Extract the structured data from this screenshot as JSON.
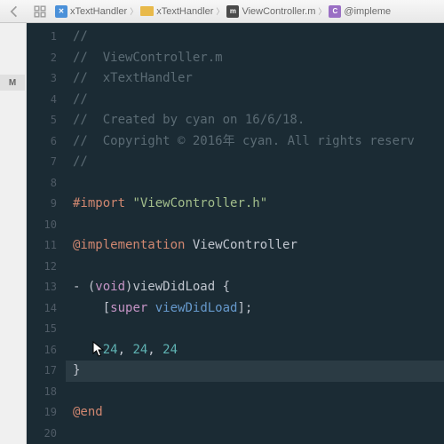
{
  "toolbar": {
    "back_icon": "chevron-left",
    "grid_icon": "grid"
  },
  "breadcrumb": {
    "items": [
      {
        "icon": "proj",
        "label": "xTextHandler"
      },
      {
        "icon": "folder",
        "label": "xTextHandler"
      },
      {
        "icon": "m",
        "label": "ViewController.m"
      },
      {
        "icon": "c",
        "label": "@impleme"
      }
    ]
  },
  "sidebar": {
    "tab_label": "M"
  },
  "gutter": {
    "lines": [
      "1",
      "2",
      "3",
      "4",
      "5",
      "6",
      "7",
      "8",
      "9",
      "10",
      "11",
      "12",
      "13",
      "14",
      "15",
      "16",
      "17",
      "18",
      "19",
      "20"
    ],
    "breakpoint_line": 16,
    "highlight_line": 17
  },
  "code": {
    "l1": "//",
    "l2": "//  ViewController.m",
    "l3": "//  xTextHandler",
    "l4": "//",
    "l5": "//  Created by cyan on 16/6/18.",
    "l6": "//  Copyright © 2016年 cyan. All rights reserv",
    "l7": "//",
    "l9a": "#import ",
    "l9b": "\"ViewController.h\"",
    "l11a": "@implementation",
    "l11b": " ViewController",
    "l13a": "- (",
    "l13b": "void",
    "l13c": ")viewDidLoad {",
    "l14a": "    [",
    "l14b": "super",
    "l14c": " ",
    "l14d": "viewDidLoad",
    "l14e": "];",
    "l16a": "    ",
    "l16n1": "24",
    "l16c1": ", ",
    "l16n2": "24",
    "l16c2": ", ",
    "l16n3": "24",
    "l17": "}",
    "l19": "@end"
  }
}
